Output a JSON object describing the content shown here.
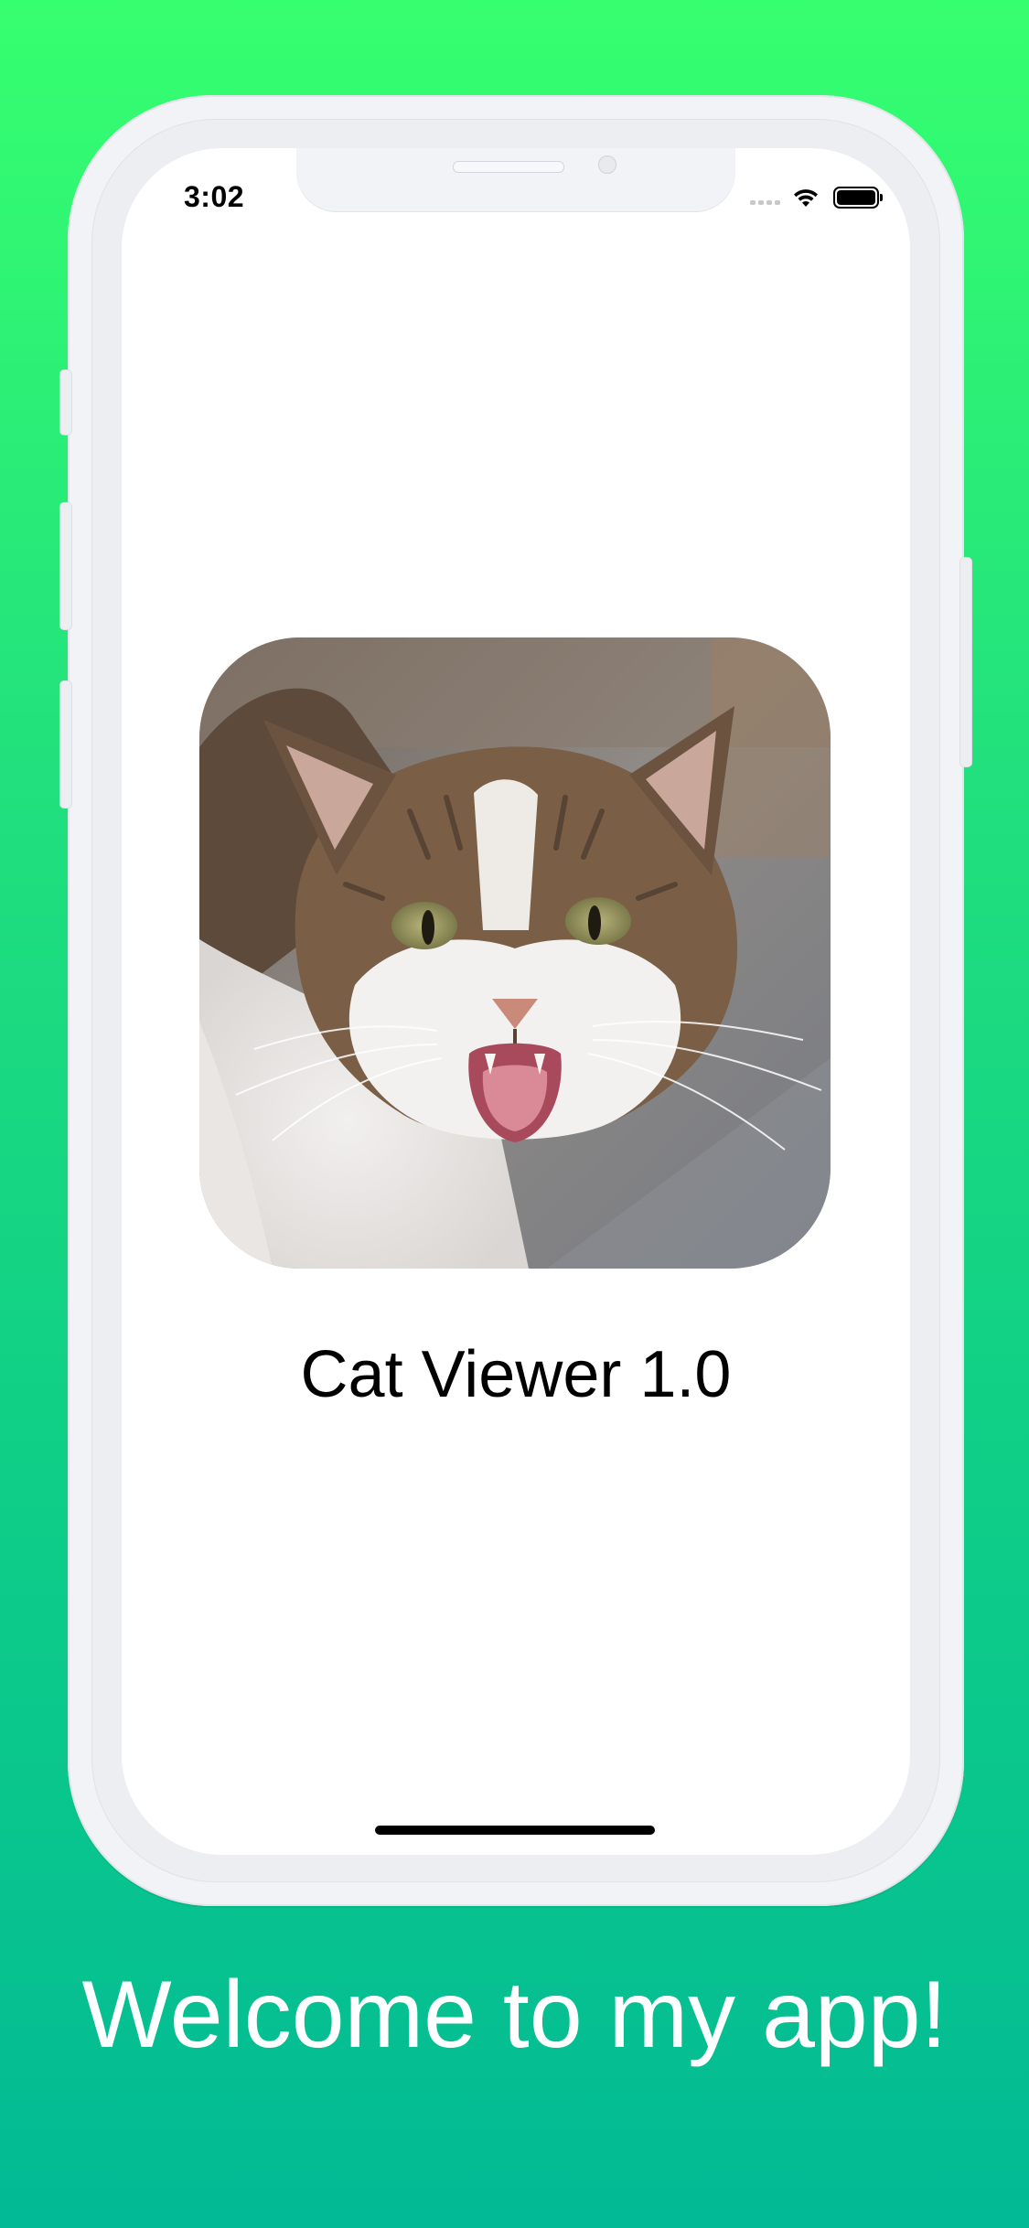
{
  "status_bar": {
    "time": "3:02",
    "icons": [
      "signal-icon",
      "wifi-icon",
      "battery-icon"
    ]
  },
  "app": {
    "image": "cat-photo",
    "title": "Cat Viewer 1.0"
  },
  "caption": {
    "text": "Welcome to my app!"
  },
  "colors": {
    "gradient_top": "#36ff6f",
    "gradient_bottom": "#02ba95",
    "screen_background": "#ffffff",
    "text_dark": "#000000",
    "text_light": "#ffffff"
  }
}
